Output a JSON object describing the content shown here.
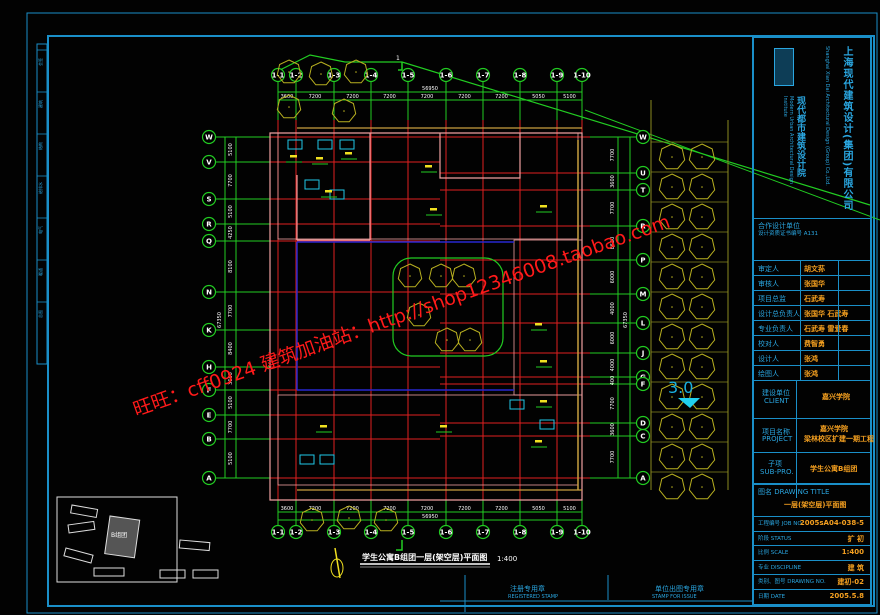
{
  "drawing": {
    "title": "学生公寓B组团一层(架空层)平面图",
    "scale": "1:400",
    "overall_width_dim": "56950",
    "overall_height_dim": "67350",
    "top_dims": [
      "3600",
      "7200",
      "7200",
      "7200",
      "7200",
      "7200",
      "7200",
      "5050",
      "5100"
    ],
    "bottom_dims": [
      "3600",
      "7200",
      "7200",
      "7200",
      "7200",
      "7200",
      "7200",
      "5050",
      "5100"
    ],
    "col_axes": [
      "1",
      "2",
      "3",
      "4",
      "5",
      "6",
      "7",
      "8",
      "9",
      "10"
    ],
    "left_axes": [
      "W",
      "V",
      "S",
      "R",
      "Q",
      "N",
      "K",
      "H",
      "F",
      "E",
      "B",
      "A"
    ],
    "left_dims": [
      "5100",
      "7700",
      "5100",
      "4250",
      "8100",
      "7700",
      "8400",
      "3600",
      "5100",
      "7700",
      "5100"
    ],
    "right_axes": [
      "W",
      "U",
      "T",
      "R",
      "P",
      "M",
      "L",
      "J",
      "G",
      "F",
      "D",
      "C",
      "A"
    ],
    "right_dims": [
      "7700",
      "3600",
      "7700",
      "8650",
      "6000",
      "4000",
      "6000",
      "4000",
      "400",
      "7700",
      "3600",
      "7700"
    ],
    "level_mark": "3.0",
    "section_mark": "1"
  },
  "watermarks": [
    "旺旺：cff0924  建筑加油站：http://shop12346008.taobao.com"
  ],
  "title_block": {
    "company_cn": "上海现代建筑设计(集团)有限公司",
    "company_en": "Shanghai Xian Dai Architectural Design (Group) Co.,Ltd.",
    "institute_cn": "现代都市建筑设计院",
    "institute_en": "Modern Urban Architectural Design Institute",
    "cert_label": "合作设计单位",
    "cert_text": "设计资质证书编号 A131",
    "roles": [
      {
        "label": "审定人",
        "value": "胡文荪"
      },
      {
        "label": "审核人",
        "value": "张国华"
      },
      {
        "label": "项目总监",
        "value": "石武寿"
      },
      {
        "label": "设计总负责人",
        "value": "张国华  石武寿"
      },
      {
        "label": "专业负责人",
        "value": "石武寿  雷爱春"
      },
      {
        "label": "校对人",
        "value": "费智勇"
      },
      {
        "label": "设计人",
        "value": "张鸿"
      },
      {
        "label": "绘图人",
        "value": "张鸿"
      }
    ],
    "client_label_cn": "建设单位",
    "client_label_en": "CLIENT",
    "client_value": "嘉兴学院",
    "project_label_cn": "项目名称",
    "project_label_en": "PROJECT",
    "project_value_1": "嘉兴学院",
    "project_value_2": "梁林校区扩建一期工程",
    "subpro_label_cn": "子项",
    "subpro_label_en": "SUB-PRO.",
    "subpro_value": "学生公寓B组团",
    "drawing_title_label": "图名 DRAWING TITLE",
    "drawing_title_value": "一层(架空层)平面图",
    "info": [
      {
        "label": "工程编号 JOB NO.",
        "value": "2005sA04-038-5"
      },
      {
        "label": "阶段 STATUS",
        "value": "扩 初"
      },
      {
        "label": "比例 SCALE",
        "value": "1:400"
      },
      {
        "label": "专业 DISCIPLINE",
        "value": "建 筑"
      },
      {
        "label": "类别、图号 DRAWING NO.",
        "value": "建初-02"
      },
      {
        "label": "日期 DATE",
        "value": "2005.5.8"
      }
    ]
  },
  "stamps": [
    {
      "cn": "注册专用章",
      "en": "REGISTERED STAMP"
    },
    {
      "cn": "单位出图专用章",
      "en": "STAMP FOR ISSUE"
    }
  ],
  "left_strip": [
    "会签",
    "建筑",
    "结构",
    "给排水",
    "电气",
    "暖通",
    "总图"
  ],
  "keyplan": {
    "label": "B组团"
  },
  "colors": {
    "grid": "#e02020",
    "axis": "#22e022",
    "frame": "#1a8fc8",
    "wall": "#f0a0a0",
    "tree": "#b8b020",
    "text_orange": "#f5a020",
    "text_cyan": "#2aa6e0"
  }
}
